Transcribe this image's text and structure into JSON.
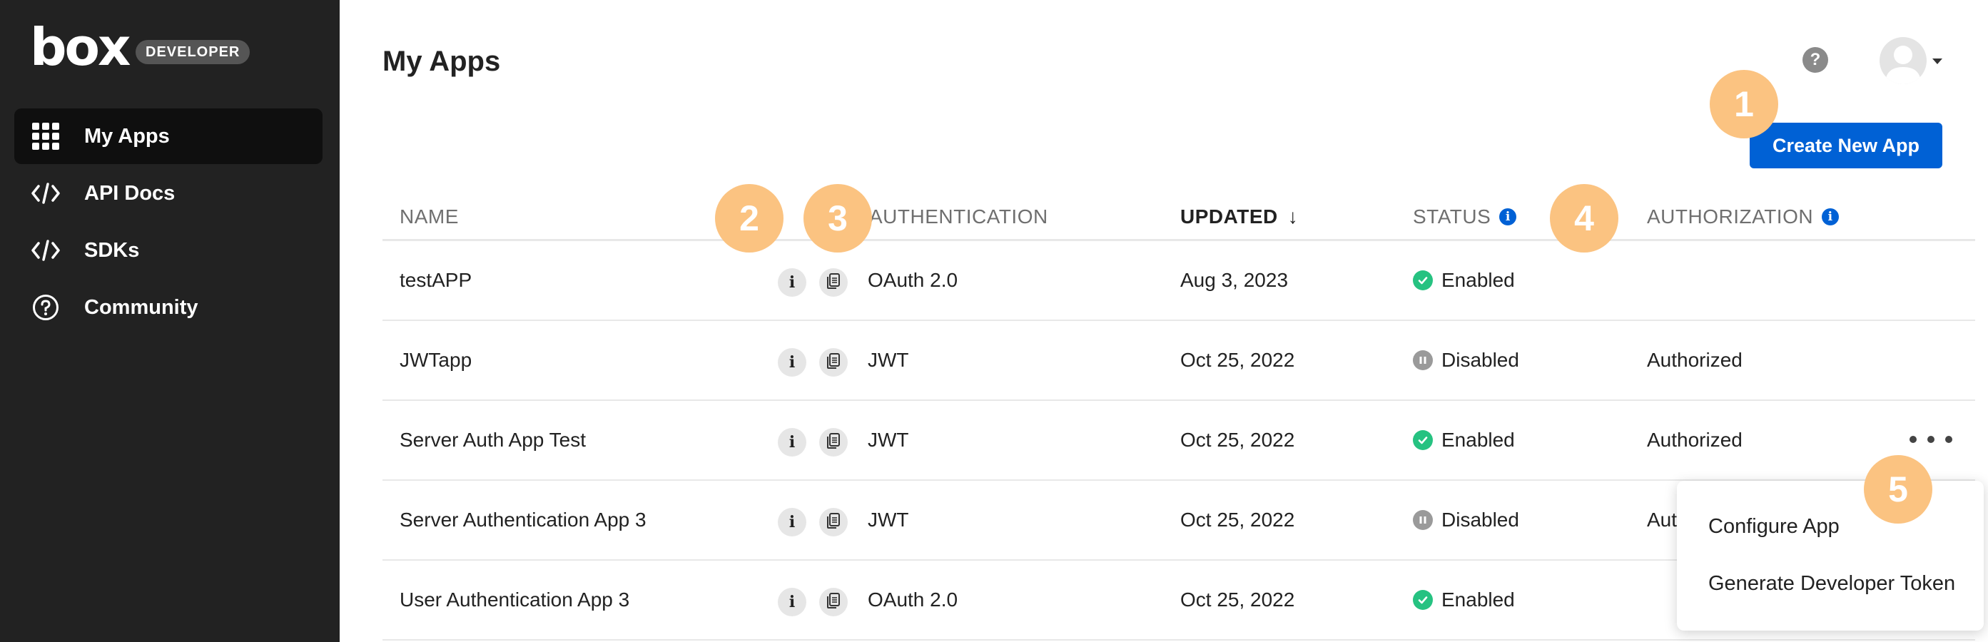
{
  "brand": {
    "logo_text": "box",
    "badge": "DEVELOPER"
  },
  "sidebar": {
    "items": [
      {
        "label": "My Apps",
        "icon": "grid-icon",
        "active": true
      },
      {
        "label": "API Docs",
        "icon": "code-icon",
        "active": false
      },
      {
        "label": "SDKs",
        "icon": "code-icon",
        "active": false
      },
      {
        "label": "Community",
        "icon": "question-circle-icon",
        "active": false
      }
    ]
  },
  "header": {
    "title": "My Apps",
    "help_glyph": "?",
    "create_button": "Create New App"
  },
  "table": {
    "columns": {
      "name": "NAME",
      "authentication": "AUTHENTICATION",
      "updated": "UPDATED",
      "updated_sort": "↓",
      "status": "STATUS",
      "authorization": "AUTHORIZATION"
    },
    "info_glyph": "i",
    "rows": [
      {
        "name": "testAPP",
        "authentication": "OAuth 2.0",
        "updated": "Aug 3, 2023",
        "status": "Enabled",
        "authorization": ""
      },
      {
        "name": "JWTapp",
        "authentication": "JWT",
        "updated": "Oct 25, 2022",
        "status": "Disabled",
        "authorization": "Authorized"
      },
      {
        "name": "Server Auth App Test",
        "authentication": "JWT",
        "updated": "Oct 25, 2022",
        "status": "Enabled",
        "authorization": "Authorized"
      },
      {
        "name": "Server Authentication App 3",
        "authentication": "JWT",
        "updated": "Oct 25, 2022",
        "status": "Disabled",
        "authorization": "Aut"
      },
      {
        "name": "User Authentication App 3",
        "authentication": "OAuth 2.0",
        "updated": "Oct 25, 2022",
        "status": "Enabled",
        "authorization": ""
      }
    ]
  },
  "menu": {
    "items": [
      "Configure App",
      "Generate Developer Token"
    ]
  },
  "callouts": [
    "1",
    "2",
    "3",
    "4",
    "5"
  ],
  "colors": {
    "sidebar_bg": "#222222",
    "accent": "#0061d5",
    "enabled": "#26c281",
    "disabled": "#9a9a9a",
    "callout": "#fbc381"
  }
}
